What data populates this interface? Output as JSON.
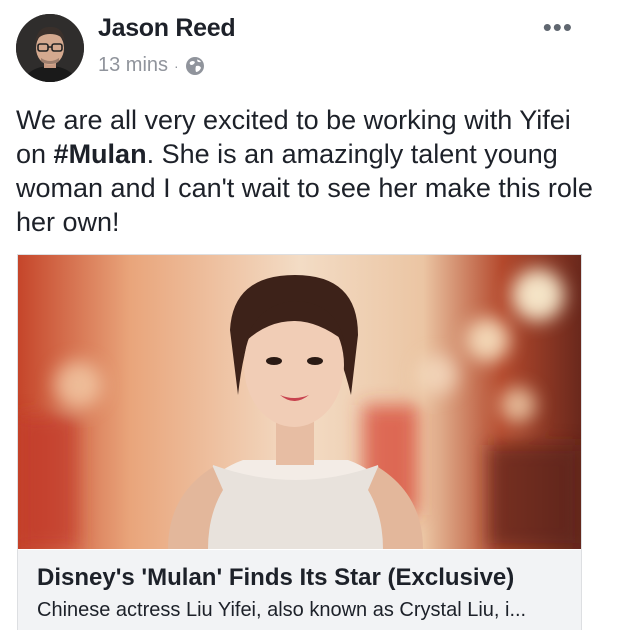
{
  "post": {
    "author": "Jason Reed",
    "time": "13 mins",
    "separator": "·",
    "privacy_icon": "globe-icon",
    "more_icon": "more-dots-icon",
    "more_label": "•••",
    "text_part1": "We are all very excited to be working with Yifei on ",
    "hashtag": "#Mulan",
    "text_part2": ".  She is an amazingly talent young woman and I can't wait to see her make this role her own!"
  },
  "link_card": {
    "title": "Disney's 'Mulan' Finds Its Star (Exclusive)",
    "description": "Chinese actress Liu Yifei, also known as Crystal Liu, i..."
  }
}
